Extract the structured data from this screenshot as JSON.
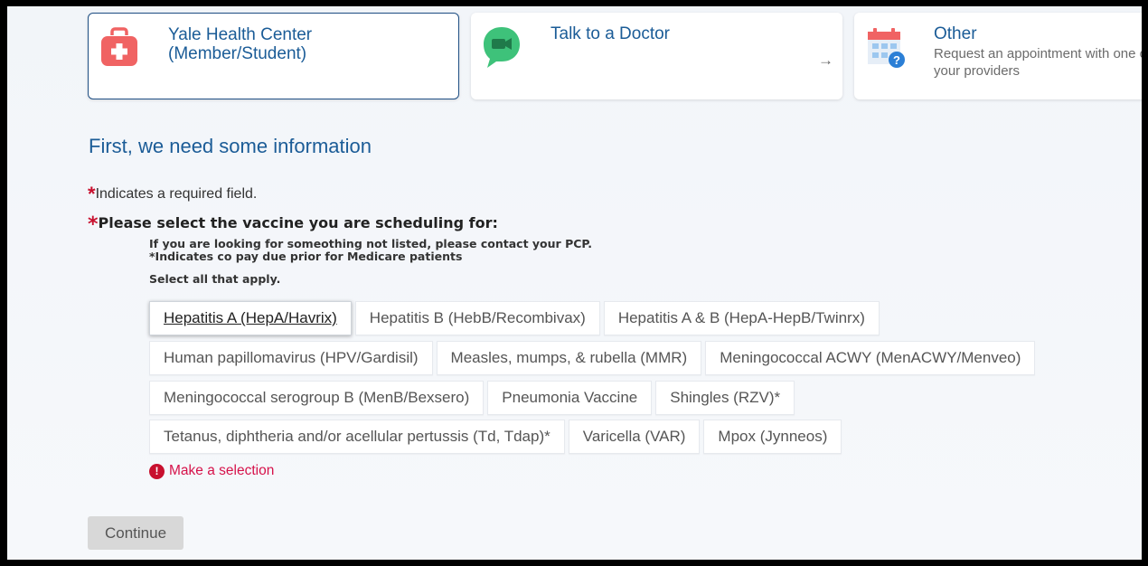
{
  "cards": [
    {
      "title_line1": "Yale Health Center",
      "title_line2": "(Member/Student)"
    },
    {
      "title": "Talk to a Doctor",
      "arrow": "→"
    },
    {
      "title": "Other",
      "desc_line1": "Request an appointment with one of",
      "desc_line2": "your providers"
    }
  ],
  "form": {
    "heading": "First, we need some information",
    "required_star": "*",
    "required_note": "Indicates a required field.",
    "question": "Please select the vaccine you are scheduling for:",
    "note_line1": "If you are looking for someothing not listed, please contact your PCP.",
    "note_line2": "*Indicates co pay due prior for Medicare patients",
    "select_all": "Select all that apply.",
    "vaccines": [
      "Hepatitis A (HepA/Havrix)",
      "Hepatitis B (HebB/Recombivax)",
      "Hepatitis A & B (HepA-HepB/Twinrx)",
      "Human papillomavirus (HPV/Gardisil)",
      "Measles, mumps, & rubella (MMR)",
      "Meningococcal ACWY (MenACWY/Menveo)",
      "Meningococcal serogroup B (MenB/Bexsero)",
      "Pneumonia Vaccine",
      "Shingles (RZV)*",
      "Tetanus, diphtheria and/or acellular pertussis (Td, Tdap)*",
      "Varicella (VAR)",
      "Mpox (Jynneos)"
    ],
    "error_icon": "!",
    "error": "Make a selection",
    "continue_label": "Continue"
  },
  "colors": {
    "accent": "#1b5c97",
    "error": "#d6124a",
    "card_icon_red": "#f06363",
    "card_icon_green": "#3ec27a"
  }
}
